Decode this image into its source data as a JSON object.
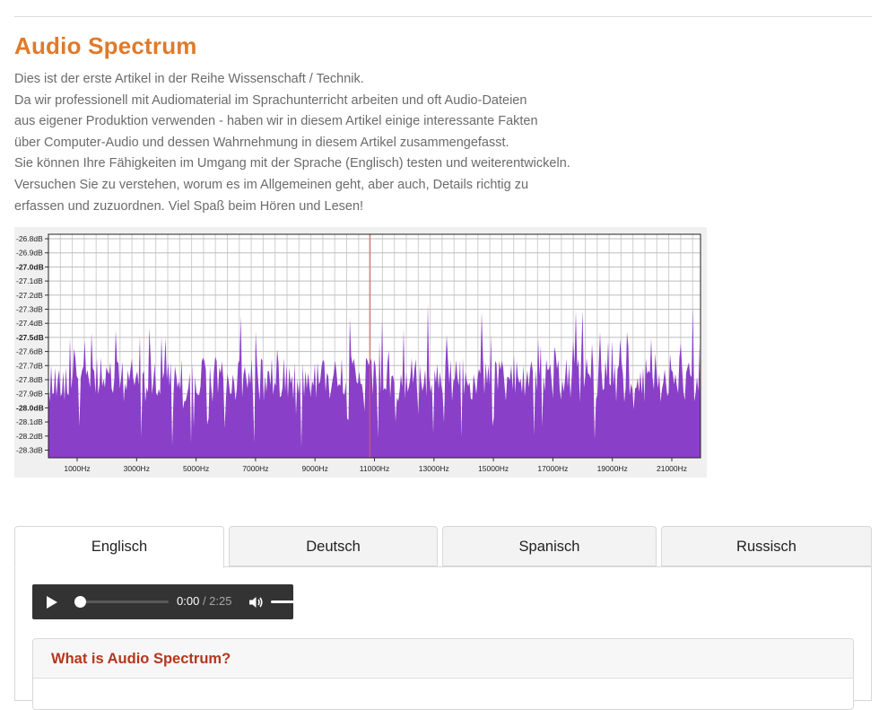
{
  "article": {
    "title": "Audio Spectrum",
    "intro_lines": [
      "Dies ist der erste Artikel in der Reihe Wissenschaft / Technik.",
      "Da wir professionell mit Audiomaterial im Sprachunterricht arbeiten und oft Audio-Dateien",
      "aus eigener Produktion verwenden - haben wir in diesem Artikel einige interessante Fakten",
      "über Computer-Audio und dessen Wahrnehmung in diesem Artikel zusammengefasst.",
      "Sie können Ihre Fähigkeiten im Umgang mit der Sprache (Englisch) testen und weiterentwickeln.",
      "Versuchen Sie zu verstehen, worum es im Allgemeinen geht, aber auch, Details richtig zu",
      "erfassen und zuzuordnen. Viel Spaß beim Hören und Lesen!"
    ]
  },
  "spectrum": {
    "y_labels": [
      "-26.8dB",
      "-26.9dB",
      "-27.0dB",
      "-27.1dB",
      "-27.2dB",
      "-27.3dB",
      "-27.4dB",
      "-27.5dB",
      "-27.6dB",
      "-27.7dB",
      "-27.8dB",
      "-27.9dB",
      "-28.0dB",
      "-28.1dB",
      "-28.2dB",
      "-28.3dB"
    ],
    "y_bold": [
      "-27.0dB",
      "-27.5dB",
      "-28.0dB"
    ],
    "x_labels": [
      "1000Hz",
      "3000Hz",
      "5000Hz",
      "7000Hz",
      "9000Hz",
      "11000Hz",
      "13000Hz",
      "15000Hz",
      "17000Hz",
      "19000Hz",
      "21000Hz"
    ],
    "fill_color": "#8a3fc8",
    "marker_color": "#e05a5a",
    "marker_freq_hz": 11000
  },
  "tabs": [
    {
      "label": "Englisch",
      "active": true
    },
    {
      "label": "Deutsch",
      "active": false
    },
    {
      "label": "Spanisch",
      "active": false
    },
    {
      "label": "Russisch",
      "active": false
    }
  ],
  "player": {
    "current_time": "0:00",
    "duration": "/ 2:25",
    "play_icon": "play-icon",
    "volume_icon": "volume-icon",
    "progress": 0.0,
    "volume": 1.0
  },
  "card": {
    "title": "What is Audio Spectrum?"
  }
}
